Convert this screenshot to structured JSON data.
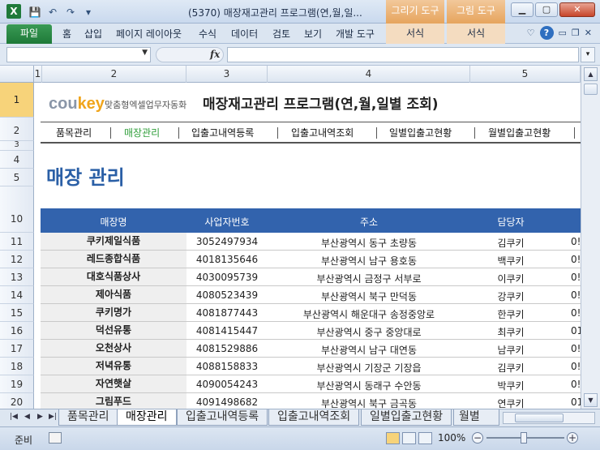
{
  "window": {
    "title": "(5370) 매장재고관리 프로그램(연,월,일...",
    "context_draw": "그리기 도구",
    "context_picture": "그림 도구",
    "minimize": "▁",
    "maximize": "▢",
    "close": "✕"
  },
  "qat": {
    "save": "💾",
    "undo": "↶",
    "redo": "↷",
    "customize": "▾"
  },
  "ribbon": {
    "file": "파일",
    "tabs": [
      "홈",
      "삽입",
      "페이지 레이아웃",
      "수식",
      "데이터",
      "검토",
      "보기",
      "개발 도구"
    ],
    "ctx_format_1": "서식",
    "ctx_format_2": "서식",
    "help": "?"
  },
  "formula_bar": {
    "name_box": "",
    "fx": "fx",
    "formula": ""
  },
  "columns": [
    "1",
    "2",
    "3",
    "4",
    "5"
  ],
  "rows": [
    "1",
    "2",
    "3",
    "4",
    "5",
    "10",
    "11",
    "12",
    "13",
    "14",
    "15",
    "16",
    "17",
    "18",
    "19",
    "20"
  ],
  "header": {
    "logo_main": "cou",
    "logo_key": "key",
    "logo_sub": "맞춤형엑셀업무자동화",
    "program_title": "매장재고관리 프로그램(연,월,일별 조회)"
  },
  "nav": {
    "items": [
      "품목관리",
      "매장관리",
      "입출고내역등록",
      "입출고내역조회",
      "일별입출고현황",
      "월별입출고현황"
    ],
    "active": "매장관리"
  },
  "page": {
    "heading": "매장 관리"
  },
  "table": {
    "headers": [
      "매장명",
      "사업자번호",
      "주소",
      "담당자"
    ],
    "rows": [
      {
        "name": "쿠키제일식품",
        "biz": "3052497934",
        "addr": "부산광역시 동구 초량동",
        "manager": "김쿠키",
        "extra": "0!"
      },
      {
        "name": "레드종합식품",
        "biz": "4018135646",
        "addr": "부산광역시 남구 용호동",
        "manager": "백쿠키",
        "extra": "0!"
      },
      {
        "name": "대호식품상사",
        "biz": "4030095739",
        "addr": "부산광역시 금정구 서부로",
        "manager": "이쿠키",
        "extra": "0!"
      },
      {
        "name": "제아식품",
        "biz": "4080523439",
        "addr": "부산광역시 북구 만덕동",
        "manager": "강쿠키",
        "extra": "0!"
      },
      {
        "name": "쿠키명가",
        "biz": "4081877443",
        "addr": "부산광역시 해운대구 송정중앙로",
        "manager": "한쿠키",
        "extra": "0!"
      },
      {
        "name": "덕선유통",
        "biz": "4081415447",
        "addr": "부산광역시 중구 중앙대로",
        "manager": "최쿠키",
        "extra": "01"
      },
      {
        "name": "오천상사",
        "biz": "4081529886",
        "addr": "부산광역시 남구 대연동",
        "manager": "남쿠키",
        "extra": "0!"
      },
      {
        "name": "저녁유통",
        "biz": "4088158833",
        "addr": "부산광역시 기장군 기장읍",
        "manager": "김쿠키",
        "extra": "0!"
      },
      {
        "name": "자연햇살",
        "biz": "4090054243",
        "addr": "부산광역시 동래구 수안동",
        "manager": "박쿠키",
        "extra": "0!"
      },
      {
        "name": "그림푸드",
        "biz": "4091498682",
        "addr": "부산광역시 북구 금곡동",
        "manager": "연쿠키",
        "extra": "01"
      }
    ]
  },
  "sheet_tabs": {
    "tabs": [
      "품목관리",
      "매장관리",
      "입출고내역등록",
      "입출고내역조회",
      "일별입출고현황",
      "월별"
    ],
    "active": "매장관리"
  },
  "status": {
    "ready": "준비",
    "zoom": "100%",
    "zoom_minus": "−",
    "zoom_plus": "+"
  },
  "colors": {
    "table_header_bg": "#3263ad",
    "nav_active": "#2f9e3a",
    "heading": "#2a5fa6",
    "file_tab": "#1e7a38"
  }
}
